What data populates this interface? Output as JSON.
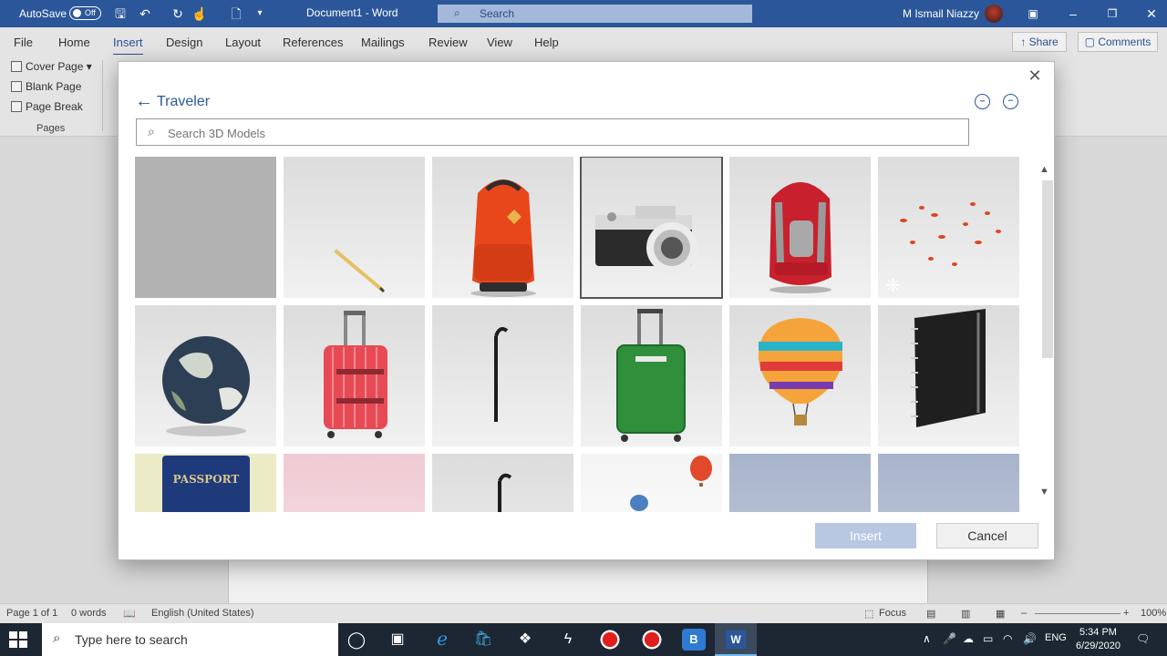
{
  "titlebar": {
    "autosave_label": "AutoSave",
    "autosave_state": "Off",
    "doc_title": "Document1  -  Word",
    "search_placeholder": "Search",
    "user_name": "M Ismail Niazzy",
    "icons": [
      "save-icon",
      "undo-icon",
      "redo-icon",
      "touch-mode-icon",
      "new-doc-icon",
      "customize-icon",
      "ribbon-display-icon",
      "minimize-icon",
      "restore-icon",
      "close-icon"
    ]
  },
  "ribbon": {
    "tabs": [
      "File",
      "Home",
      "Insert",
      "Design",
      "Layout",
      "References",
      "Mailings",
      "Review",
      "View",
      "Help"
    ],
    "active_tab": "Insert",
    "share_label": "Share",
    "comments_label": "Comments",
    "pages_group": {
      "items": [
        "Cover Page",
        "Blank Page",
        "Page Break"
      ],
      "label": "Pages"
    }
  },
  "dialog": {
    "title": "Traveler",
    "search_placeholder": "Search 3D Models",
    "insert_label": "Insert",
    "cancel_label": "Cancel",
    "feedback_icons": [
      "smile-icon",
      "frown-icon"
    ],
    "models": [
      {
        "subject": "blank",
        "selected": false
      },
      {
        "subject": "pencil",
        "selected": false
      },
      {
        "subject": "orange-backpack",
        "selected": false
      },
      {
        "subject": "camera",
        "selected": true
      },
      {
        "subject": "red-backpack",
        "selected": false
      },
      {
        "subject": "falling-leaves",
        "selected": false,
        "animated": true
      },
      {
        "subject": "globe",
        "selected": false
      },
      {
        "subject": "red-suitcase",
        "selected": false
      },
      {
        "subject": "walking-cane",
        "selected": false
      },
      {
        "subject": "green-suitcase",
        "selected": false
      },
      {
        "subject": "hot-air-balloon",
        "selected": false
      },
      {
        "subject": "notebook",
        "selected": false
      },
      {
        "subject": "passport",
        "selected": false,
        "label": "PASSPORT"
      },
      {
        "subject": "pink-blank",
        "selected": false
      },
      {
        "subject": "walking-cane",
        "selected": false
      },
      {
        "subject": "balloons",
        "selected": false
      },
      {
        "subject": "blue-blank",
        "selected": false
      },
      {
        "subject": "blue-blank",
        "selected": false
      }
    ],
    "colors": {
      "accent": "#2b579a",
      "insert_disabled": "#b8c8e3"
    }
  },
  "statusbar": {
    "page": "Page 1 of 1",
    "words": "0 words",
    "language": "English (United States)",
    "focus": "Focus",
    "zoom": "100%"
  },
  "taskbar": {
    "search_placeholder": "Type here to search",
    "lang": "ENG",
    "time": "5:34 PM",
    "date": "6/29/2020"
  }
}
